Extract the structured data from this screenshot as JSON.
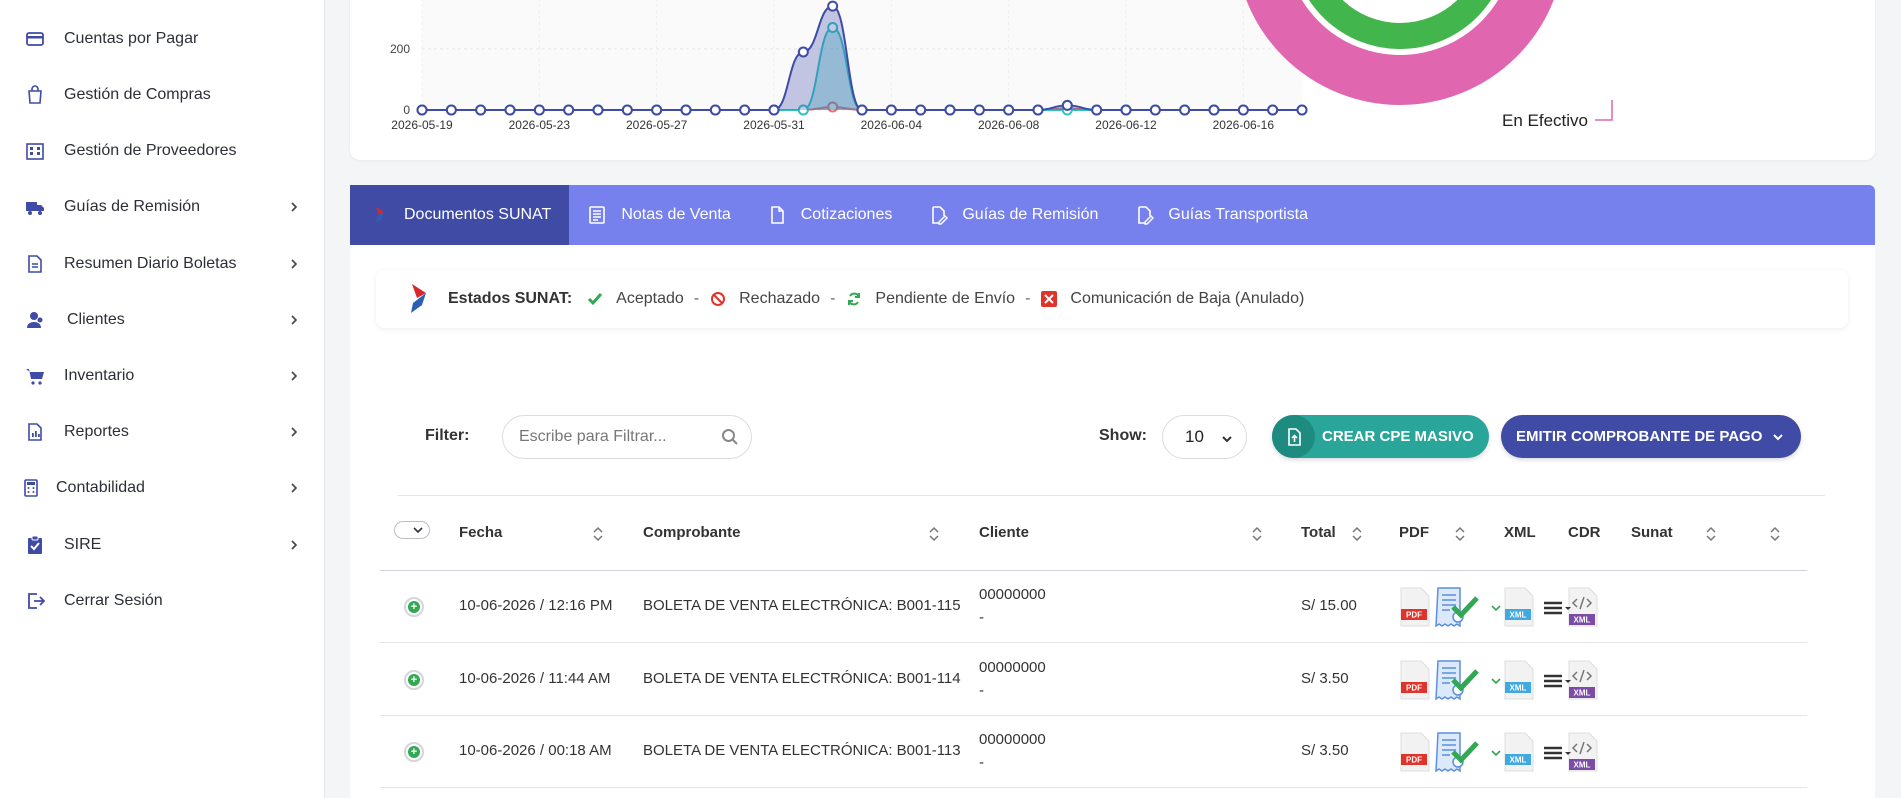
{
  "sidebar": {
    "items": [
      {
        "label": "Cuentas por Pagar",
        "icon": "credit-card-icon",
        "has_arrow": false
      },
      {
        "label": "Gestión de Compras",
        "icon": "shopping-bag-icon",
        "has_arrow": false
      },
      {
        "label": "Gestión de Proveedores",
        "icon": "building-icon",
        "has_arrow": false
      },
      {
        "label": "Guías de Remisión",
        "icon": "truck-icon",
        "has_arrow": true
      },
      {
        "label": "Resumen Diario Boletas",
        "icon": "document-icon",
        "has_arrow": true
      },
      {
        "label": "Clientes",
        "icon": "users-icon",
        "has_arrow": true
      },
      {
        "label": "Inventario",
        "icon": "cart-icon",
        "has_arrow": true
      },
      {
        "label": "Reportes",
        "icon": "report-icon",
        "has_arrow": true
      },
      {
        "label": "Contabilidad",
        "icon": "calculator-icon",
        "has_arrow": true
      },
      {
        "label": "SIRE",
        "icon": "clipboard-check-icon",
        "has_arrow": true
      },
      {
        "label": "Cerrar Sesión",
        "icon": "logout-icon",
        "has_arrow": false
      }
    ]
  },
  "chart": {
    "donut_label": "En Efectivo"
  },
  "chart_data": {
    "type": "area",
    "x": [
      "2026-05-19",
      "2026-05-20",
      "2026-05-21",
      "2026-05-22",
      "2026-05-23",
      "2026-05-24",
      "2026-05-25",
      "2026-05-26",
      "2026-05-27",
      "2026-05-28",
      "2026-05-29",
      "2026-05-30",
      "2026-05-31",
      "2026-06-01",
      "2026-06-02",
      "2026-06-03",
      "2026-06-04",
      "2026-06-05",
      "2026-06-06",
      "2026-06-07",
      "2026-06-08",
      "2026-06-09",
      "2026-06-10",
      "2026-06-11",
      "2026-06-12",
      "2026-06-13",
      "2026-06-14",
      "2026-06-15",
      "2026-06-16",
      "2026-06-17",
      "2026-06-18"
    ],
    "x_ticks": [
      "2026-05-19",
      "2026-05-23",
      "2026-05-27",
      "2026-05-31",
      "2026-06-04",
      "2026-06-08",
      "2026-06-12",
      "2026-06-16"
    ],
    "y_ticks": [
      0,
      200
    ],
    "series": [
      {
        "color": "#3f4ba5",
        "values": [
          0,
          0,
          0,
          0,
          0,
          0,
          0,
          0,
          0,
          0,
          0,
          0,
          0,
          190,
          340,
          0,
          0,
          0,
          0,
          0,
          0,
          0,
          15,
          0,
          0,
          0,
          0,
          0,
          0,
          0,
          0
        ]
      },
      {
        "color": "#2ec4c4",
        "values": [
          0,
          0,
          0,
          0,
          0,
          0,
          0,
          0,
          0,
          0,
          0,
          0,
          0,
          0,
          270,
          0,
          0,
          0,
          0,
          0,
          0,
          0,
          0,
          0,
          0,
          0,
          0,
          0,
          0,
          0,
          0
        ]
      },
      {
        "color": "#e57373",
        "values": [
          0,
          0,
          0,
          0,
          0,
          0,
          0,
          0,
          0,
          0,
          0,
          0,
          0,
          0,
          10,
          0,
          0,
          0,
          0,
          0,
          0,
          0,
          5,
          0,
          0,
          0,
          0,
          0,
          0,
          0,
          0
        ]
      }
    ]
  },
  "tabs": [
    {
      "label": "Documentos SUNAT",
      "icon": "sunat-logo-icon",
      "active": true
    },
    {
      "label": "Notas de Venta",
      "icon": "notes-icon",
      "active": false
    },
    {
      "label": "Cotizaciones",
      "icon": "file-icon",
      "active": false
    },
    {
      "label": "Guías de Remisión",
      "icon": "file-edit-icon",
      "active": false
    },
    {
      "label": "Guías Transportista",
      "icon": "file-edit-icon",
      "active": false
    }
  ],
  "estados": {
    "title": "Estados SUNAT:",
    "aceptado": "Aceptado",
    "rechazado": "Rechazado",
    "pendiente": "Pendiente de Envío",
    "baja": "Comunicación de Baja (Anulado)",
    "sep": "-"
  },
  "filter": {
    "label": "Filter:",
    "placeholder": "Escribe para Filtrar...",
    "show_label": "Show:",
    "show_value": "10"
  },
  "buttons": {
    "masivo": "CREAR CPE MASIVO",
    "emitir": "EMITIR COMPROBANTE DE PAGO"
  },
  "table": {
    "headers": {
      "fecha": "Fecha",
      "comprobante": "Comprobante",
      "cliente": "Cliente",
      "total": "Total",
      "pdf": "PDF",
      "xml": "XML",
      "cdr": "CDR",
      "sunat": "Sunat"
    },
    "rows": [
      {
        "fecha": "10-06-2026 / 12:16 PM",
        "comprobante": "BOLETA DE VENTA ELECTRÓNICA: B001-115",
        "cliente": "00000000",
        "cliente2": "-",
        "total": "S/ 15.00"
      },
      {
        "fecha": "10-06-2026 / 11:44 AM",
        "comprobante": "BOLETA DE VENTA ELECTRÓNICA: B001-114",
        "cliente": "00000000",
        "cliente2": "-",
        "total": "S/ 3.50"
      },
      {
        "fecha": "10-06-2026 / 00:18 AM",
        "comprobante": "BOLETA DE VENTA ELECTRÓNICA: B001-113",
        "cliente": "00000000",
        "cliente2": "-",
        "total": "S/ 3.50"
      }
    ]
  },
  "file_labels": {
    "pdf": "PDF",
    "xml": "XML"
  },
  "colors": {
    "primary": "#3f4ba5",
    "tabs_bg": "#7681ee",
    "teal": "#2aa59a",
    "success": "#32a852",
    "donut_pink": "#e066b0",
    "donut_green": "#43b54d"
  }
}
